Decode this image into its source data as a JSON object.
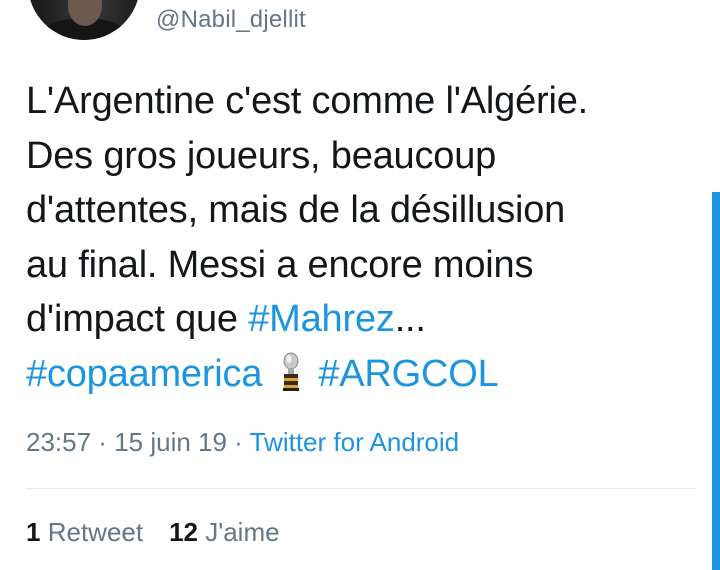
{
  "user": {
    "handle": "@Nabil_djellit",
    "avatar_icon": "profile-photo"
  },
  "tweet": {
    "line1": "L'Argentine c'est comme l'Algérie.",
    "line2": "Des gros joueurs, beaucoup",
    "line3": "d'attentes, mais de la désillusion",
    "line4": "au final. Messi a encore moins",
    "line5_prefix": "d'impact que ",
    "line5_hashtag": "#Mahrez",
    "line5_suffix": "...",
    "hashtag_copa": "#copaamerica",
    "emoji_icon": "trophy-icon",
    "hashtag_argcol": "#ARGCOL"
  },
  "meta": {
    "time": "23:57",
    "separator": " · ",
    "date": "15 juin 19",
    "source": "Twitter for Android"
  },
  "stats": {
    "retweets_count": "1",
    "retweets_label": "Retweet",
    "likes_count": "12",
    "likes_label": "J'aime"
  },
  "colors": {
    "link": "#1b95e0",
    "secondary_text": "#657786",
    "primary_text": "#14171a",
    "divider": "#e1e8ed"
  }
}
